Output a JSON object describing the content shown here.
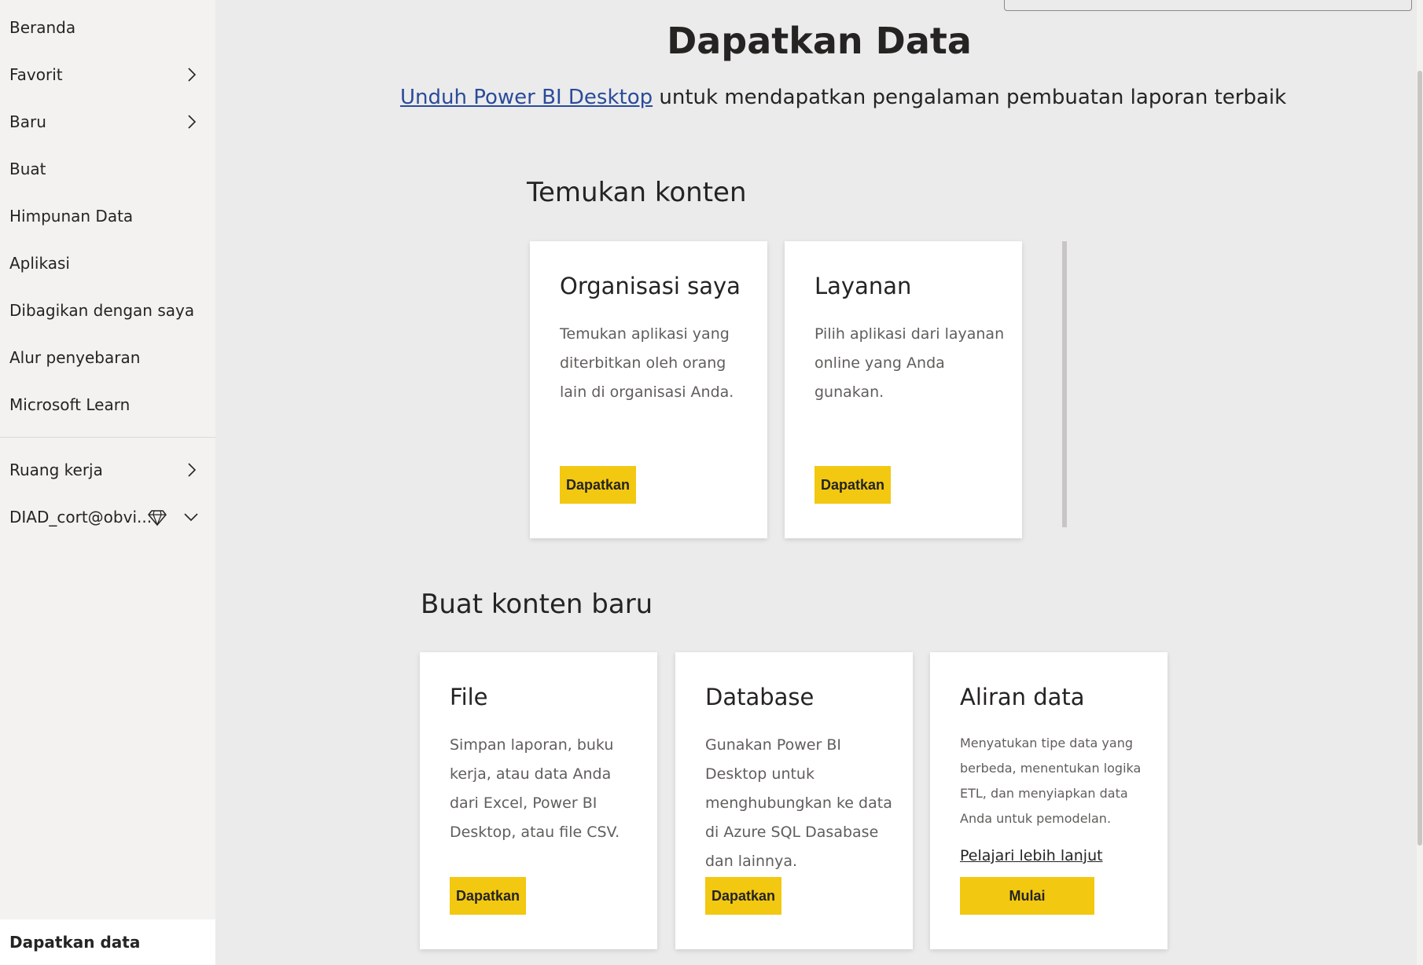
{
  "sidebar": {
    "items": [
      {
        "label": "Beranda"
      },
      {
        "label": "Favorit"
      },
      {
        "label": "Baru"
      },
      {
        "label": "Buat"
      },
      {
        "label": "Himpunan Data"
      },
      {
        "label": "Aplikasi"
      },
      {
        "label": "Dibagikan dengan saya"
      },
      {
        "label": "Alur penyebaran"
      },
      {
        "label": "Microsoft Learn"
      },
      {
        "label": "Ruang kerja"
      },
      {
        "label": "DIAD_cort@obvi..."
      }
    ],
    "bottom_item": {
      "label": "Dapatkan data"
    }
  },
  "header": {
    "title": "Dapatkan Data",
    "download_link": "Unduh Power BI Desktop",
    "subtitle_rest": " untuk mendapatkan pengalaman pembuatan laporan terbaik"
  },
  "discover": {
    "heading": "Temukan konten",
    "cards": [
      {
        "title": "Organisasi saya",
        "description": "Temukan aplikasi yang diterbitkan oleh orang lain di organisasi Anda.",
        "button": "Dapatkan"
      },
      {
        "title": "Layanan",
        "description": "Pilih aplikasi dari layanan online yang Anda gunakan.",
        "button": "Dapatkan"
      }
    ]
  },
  "create": {
    "heading": "Buat konten baru",
    "cards": [
      {
        "title": "File",
        "description": "Simpan laporan, buku kerja, atau data Anda dari Excel, Power BI Desktop, atau file CSV.",
        "button": "Dapatkan"
      },
      {
        "title": "Database",
        "description": "Gunakan Power BI Desktop untuk menghubungkan ke data di Azure SQL Dasabase dan lainnya.",
        "button": "Dapatkan"
      },
      {
        "title": "Aliran data",
        "description": "Menyatukan tipe data yang berbeda, menentukan logika ETL, dan menyiapkan data Anda untuk pemodelan.",
        "link": "Pelajari lebih lanjut",
        "button": "Mulai"
      }
    ]
  },
  "colors": {
    "accent": "#f2c811",
    "link": "#2a4b9b",
    "sidebar_bg": "#f3f2f1",
    "page_bg": "#ebebeb"
  }
}
